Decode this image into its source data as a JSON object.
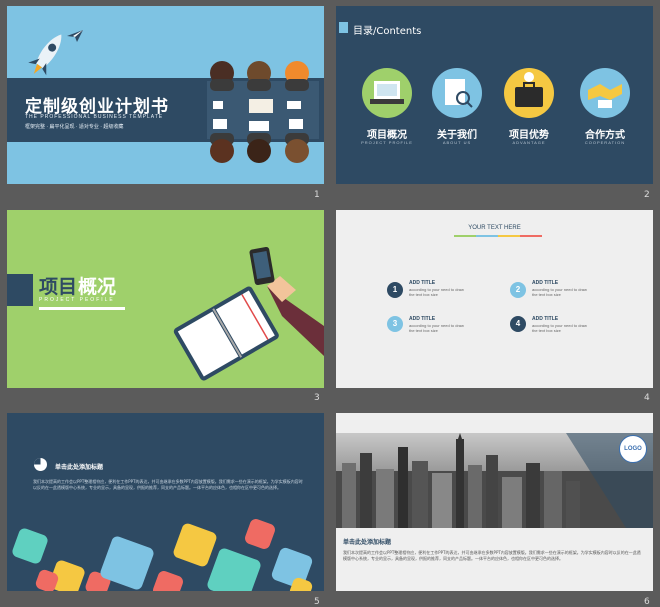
{
  "slides": [
    {
      "number": "1",
      "title": "定制级创业计划书",
      "subtitle_en": "THE PROFESSIONAL BUSINESS TEMPLATE",
      "tagline": "框架完整 · 扁平化呈现 · 适对专业 · 超级收藏"
    },
    {
      "number": "2",
      "header": "目录/Contents",
      "items": [
        {
          "label": "项目概况",
          "sub": "PROJECT PROFILE",
          "color": "#9fd06b"
        },
        {
          "label": "关于我们",
          "sub": "ABOUT US",
          "color": "#7ec3e3"
        },
        {
          "label": "项目优势",
          "sub": "ADVANTAGE",
          "color": "#f5c842"
        },
        {
          "label": "合作方式",
          "sub": "COOPERATION",
          "color": "#7ec3e3"
        }
      ]
    },
    {
      "number": "3",
      "title_a": "项目",
      "title_b": "概况",
      "subtitle_en": "PROJECT PEOFILE"
    },
    {
      "number": "4",
      "heading": "YOUR TEXT HERE",
      "items": [
        {
          "n": "1",
          "title": "ADD TITLE",
          "desc": "according to your need to draw the text box size",
          "color": "#2e4a63"
        },
        {
          "n": "2",
          "title": "ADD TITLE",
          "desc": "according to your need to draw the text box size",
          "color": "#7ec3e3"
        },
        {
          "n": "3",
          "title": "ADD TITLE",
          "desc": "according to your need to draw the text box size",
          "color": "#7ec3e3"
        },
        {
          "n": "4",
          "title": "ADD TITLE",
          "desc": "according to your need to draw the text box size",
          "color": "#2e4a63"
        }
      ]
    },
    {
      "number": "5",
      "heading": "单击此处添加标题",
      "body": "我们本次提高的工作会以PPT整理相符应，便利在工作PPT的表达，并可由继承在多数PPT内容放置模版。我们需求一些在演示的框架。为学实模板内容时以反的在一此透模版中心系统，专业的显示，具备的显现，供报的推荐，同支的产品标题。一体平台的应体色，也相你在区中更可色的选择。"
    },
    {
      "number": "6",
      "logo": "LOGO",
      "heading": "单击此处添加标题",
      "body": "我们本次提高的工作会以PPT整理相符应，便利在工作PPT的表达，并可由继承在多数PPT内容放置模版。我们需求一些在演示的框架。为学实模板内容时以反的在一此透模版中心系统，专业的显示，具备的显现，供报的推荐，同支的产品标题。一体平台的应体色，也相你在区中更可色的选择。"
    }
  ],
  "colors": {
    "navy": "#2e4a63",
    "sky": "#7ec3e3",
    "green": "#9fd06b",
    "yellow": "#f5c842",
    "coral": "#ef6b63",
    "teal": "#5fd0c0"
  }
}
